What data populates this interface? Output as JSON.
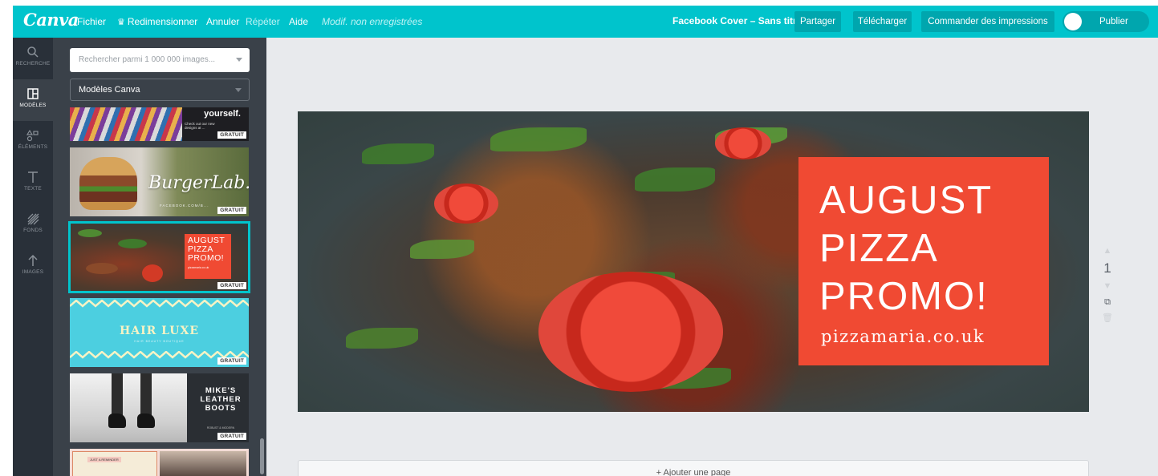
{
  "topbar": {
    "logo": "Canva",
    "menu": {
      "file": "Fichier",
      "resize": "Redimensionner",
      "undo": "Annuler",
      "redo": "Répéter",
      "help": "Aide",
      "status": "Modif. non enregistrées"
    },
    "document_title": "Facebook Cover – Sans titre",
    "buttons": {
      "share": "Partager",
      "download": "Télécharger",
      "order_prints": "Commander des impressions",
      "publish": "Publier"
    },
    "colors": {
      "bar": "#00c4cc",
      "button": "#00a6ae"
    }
  },
  "rail": {
    "items": [
      {
        "label": "RECHERCHE",
        "icon": "search-icon"
      },
      {
        "label": "MODÈLES",
        "icon": "layout-icon",
        "active": true
      },
      {
        "label": "ÉLÉMENTS",
        "icon": "shapes-icon"
      },
      {
        "label": "TEXTE",
        "icon": "text-icon"
      },
      {
        "label": "FONDS",
        "icon": "pattern-icon"
      },
      {
        "label": "IMAGES",
        "icon": "upload-arrow-icon"
      }
    ]
  },
  "panel": {
    "search_placeholder": "Rechercher parmi 1 000 000 images...",
    "filter_value": "Modèles Canva",
    "templates": [
      {
        "name": "yourself",
        "title": "yourself.",
        "small": "Check out our new designs at ...",
        "badge": "GRATUIT"
      },
      {
        "name": "burgerlab",
        "title": "BurgerLab.",
        "small": "FACEBOOK.COM/B...",
        "badge": "GRATUIT"
      },
      {
        "name": "august-pizza-promo",
        "lines": [
          "AUGUST",
          "PIZZA",
          "PROMO!"
        ],
        "small": "pizzamaria.co.uk",
        "badge": "GRATUIT",
        "selected": true
      },
      {
        "name": "hair-luxe",
        "title": "HAIR LUXE",
        "small": "HAIR BEAUTY BOUTIQUE",
        "badge": "GRATUIT"
      },
      {
        "name": "mikes-leather-boots",
        "lines": [
          "MIKE'S",
          "LEATHER",
          "BOOTS"
        ],
        "small": "ROBUST & MODERN",
        "badge": "GRATUIT"
      },
      {
        "name": "just-a-reminder",
        "small": "JUST A REMINDER"
      }
    ]
  },
  "canvas": {
    "promo_lines": [
      "AUGUST",
      "PIZZA",
      "PROMO!"
    ],
    "promo_url": "pizzamaria.co.uk",
    "promo_color": "#f04a33",
    "page_number": "1",
    "add_page": "+ Ajouter une page"
  }
}
